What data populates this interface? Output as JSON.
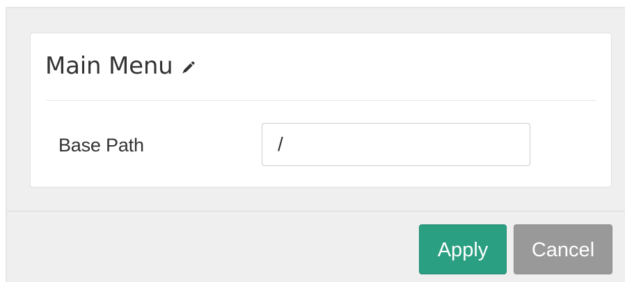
{
  "dialog": {
    "title": "Main Menu",
    "edit_icon": "pencil-icon"
  },
  "form": {
    "base_path": {
      "label": "Base Path",
      "value": "/"
    }
  },
  "actions": {
    "apply_label": "Apply",
    "cancel_label": "Cancel"
  },
  "colors": {
    "apply": "#2a9f82",
    "cancel": "#999999",
    "frame_background": "#efefef",
    "panel_background": "#ffffff"
  }
}
